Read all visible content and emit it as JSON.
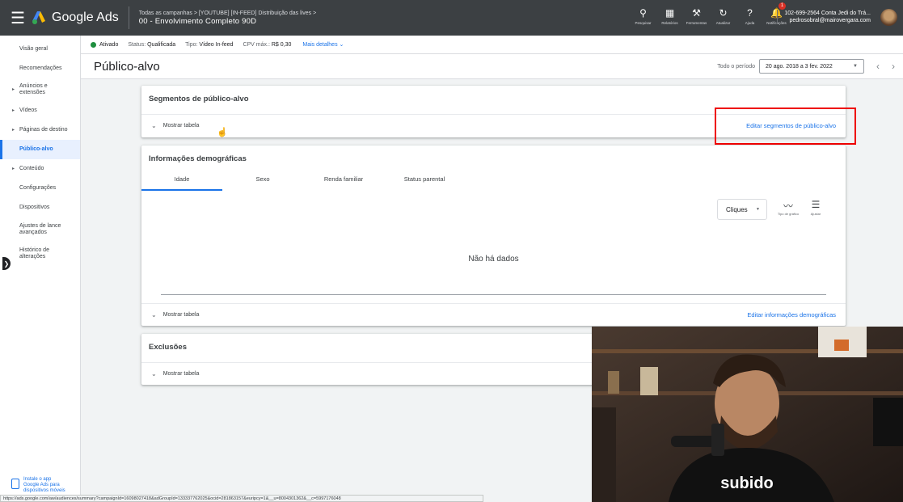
{
  "app": {
    "name": "Google Ads"
  },
  "breadcrumb": {
    "path": "Todas as campanhas  >  [YOUTUBE] [IN-FEED] Distribuição das lives  >",
    "campaign": "00 - Envolvimento Completo 90D"
  },
  "toolbar": [
    {
      "label": "Pesquisar",
      "icon": "search-icon"
    },
    {
      "label": "Relatórios",
      "icon": "reports-icon"
    },
    {
      "label": "Ferramentas",
      "icon": "tools-icon"
    },
    {
      "label": "Atualizar",
      "icon": "refresh-icon"
    },
    {
      "label": "Ajuda",
      "icon": "help-icon"
    },
    {
      "label": "Notificações",
      "icon": "bell-icon",
      "badge": "1"
    }
  ],
  "account": {
    "line1": "102-699-2564 Conta Jedi do Trá...",
    "line2": "pedrosobral@mairovergara.com"
  },
  "sidebar": {
    "items": [
      {
        "label": "Visão geral"
      },
      {
        "label": "Recomendações"
      },
      {
        "label": "Anúncios e extensões"
      },
      {
        "label": "Vídeos"
      },
      {
        "label": "Páginas de destino"
      },
      {
        "label": "Público-alvo"
      },
      {
        "label": "Conteúdo"
      },
      {
        "label": "Configurações"
      },
      {
        "label": "Dispositivos"
      },
      {
        "label": "Ajustes de lance avançados"
      },
      {
        "label": "Histórico de alterações"
      }
    ],
    "promo": "Instale o app Google Ads para dispositivos móveis"
  },
  "status": {
    "state": "Ativado",
    "status_label": "Status:",
    "status_value": "Qualificada",
    "type_label": "Tipo:",
    "type_value": "Vídeo In-feed",
    "cpv_label": "CPV máx.:",
    "cpv_value": "R$ 0,30",
    "more": "Mais detalhes"
  },
  "page": {
    "title": "Público-alvo",
    "period_label": "Todo o período",
    "period_value": "20 ago. 2018 a 3 fev. 2022"
  },
  "segments": {
    "title": "Segmentos de público-alvo",
    "show_table": "Mostrar tabela",
    "edit": "Editar segmentos de público-alvo"
  },
  "demographics": {
    "title": "Informações demográficas",
    "tabs": [
      "Idade",
      "Sexo",
      "Renda familiar",
      "Status parental"
    ],
    "metric": "Cliques",
    "chart_type": "Tipo de gráfico",
    "adjust": "Ajustar",
    "no_data": "Não há dados",
    "show_table": "Mostrar tabela",
    "edit": "Editar informações demográficas"
  },
  "exclusions": {
    "title": "Exclusões",
    "show_table": "Mostrar tabela"
  },
  "webcam": {
    "shirt_text": "subido"
  },
  "statusbar_url": "https://ads.google.com/aw/audiences/summary?campaignId=16098027418&adGroupId=133337762025&ocid=281863157&euripcy=1&__u=8004301362&__c=5997176048",
  "colors": {
    "accent": "#1a73e8",
    "topbar": "#3c4043",
    "active_green": "#1e8e3e",
    "highlight": "#ee0000"
  }
}
